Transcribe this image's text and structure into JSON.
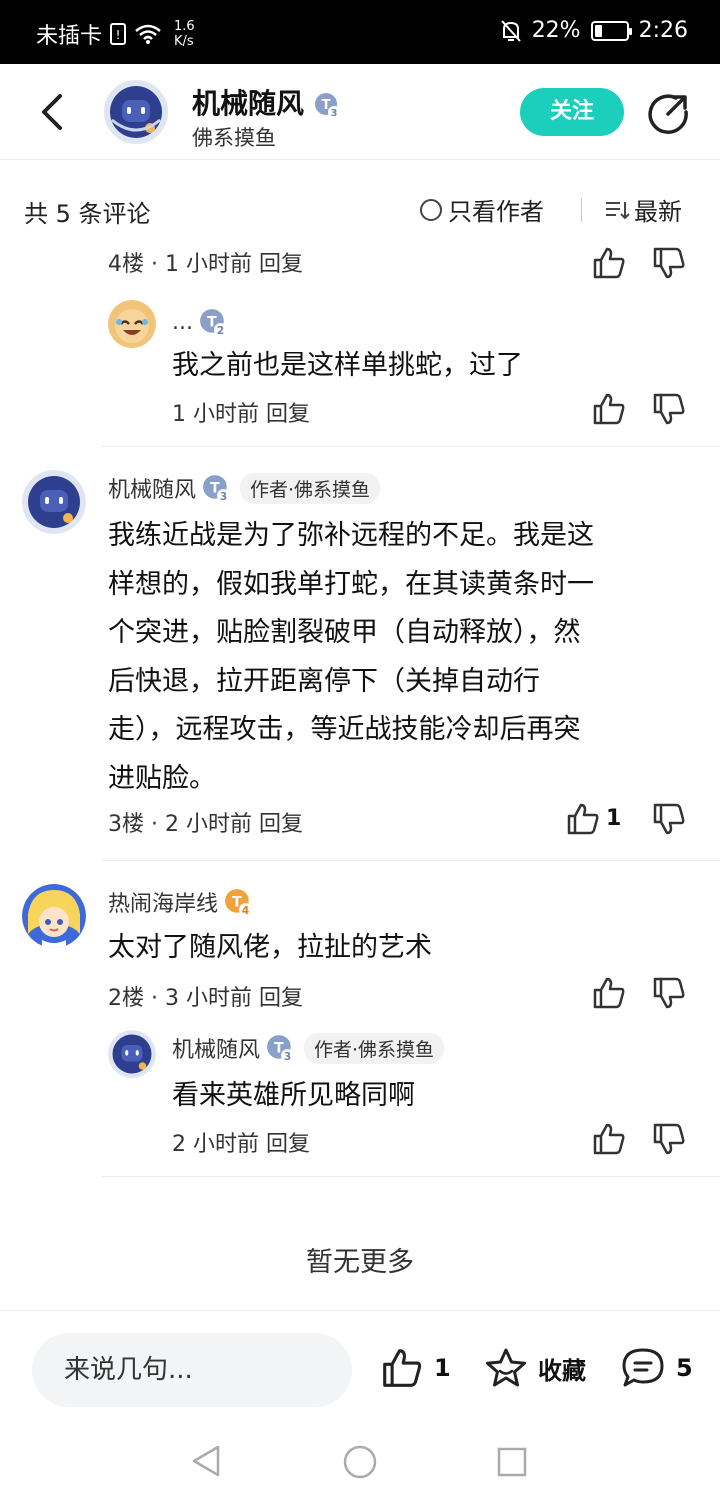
{
  "status_bar": {
    "carrier": "未插卡",
    "speed_value": "1.6",
    "speed_unit": "K/s",
    "battery": "22%",
    "battery_level": 0.22,
    "time": "2:26"
  },
  "header": {
    "name": "机械随风",
    "subtitle": "佛系摸鱼",
    "level": "3",
    "follow_label": "关注"
  },
  "sortbar": {
    "count_label": "共 5 条评论",
    "only_author_label": "只看作者",
    "sort_label": "最新"
  },
  "comments": {
    "c4_partial": {
      "meta": "4楼 · 1 小时前  回复"
    },
    "reply1": {
      "name": "...",
      "level": "2",
      "text": "我之前也是这样单挑蛇，过了",
      "meta": "1 小时前  回复"
    },
    "c3": {
      "name": "机械随风",
      "level": "3",
      "author_tag": "作者·佛系摸鱼",
      "lines": [
        "我练近战是为了弥补远程的不足。我是这",
        "样想的，假如我单打蛇，在其读黄条时一",
        "个突进，贴脸割裂破甲（自动释放），然",
        "后快退，拉开距离停下（关掉自动行",
        "走），远程攻击，等近战技能冷却后再突",
        "进贴脸。"
      ],
      "meta": "3楼 · 2 小时前  回复",
      "likes": "1"
    },
    "c2": {
      "name": "热闹海岸线",
      "level": "4",
      "text": "太对了随风佬，拉扯的艺术",
      "meta": "2楼 · 3 小时前  回复"
    },
    "reply2": {
      "name": "机械随风",
      "level": "3",
      "author_tag": "作者·佛系摸鱼",
      "text": "看来英雄所见略同啊",
      "meta": "2 小时前  回复"
    }
  },
  "no_more": "暂无更多",
  "bottom_bar": {
    "input_placeholder": "来说几句...",
    "like_count": "1",
    "favorite_label": "收藏",
    "comment_count": "5"
  },
  "colors": {
    "accent": "#1ccfbd",
    "badge_blue": "#8aa0c8",
    "badge_orange": "#f2a23a"
  }
}
